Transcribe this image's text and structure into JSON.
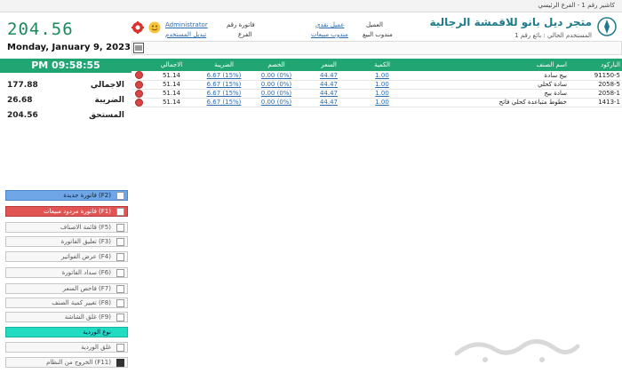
{
  "window": {
    "title": "كاشير رقم 1 - الفرع الرئيسي"
  },
  "totals": {
    "display_total": "204.56",
    "date": "Monday, January 9, 2023",
    "clock": "PM 09:58:55"
  },
  "summary": [
    {
      "label": "الاجمالي",
      "value": "177.88"
    },
    {
      "label": "الضريبة",
      "value": "26.68"
    },
    {
      "label": "المستحق",
      "value": "204.56"
    }
  ],
  "header": {
    "username_link": "Administrator",
    "change_user": "تبديل المستخدم",
    "invoice_label": "فاتورة رقم",
    "branch_label": "الفرع",
    "customer_link": "عميل نقدي",
    "rep_link": "مندوب مبيعات",
    "customer_label": "العميل",
    "rep_label": "مندوب البيع",
    "store_name": "متجر ديل بانو للاقمشة الرجالية",
    "current_user": "المستخدم الحالي : بائع رقم 1"
  },
  "table": {
    "columns": [
      "الباركود",
      "اسم الصنف",
      "الكمية",
      "السعر",
      "الخصم",
      "الضريبة",
      "الاجمالي"
    ],
    "rows": [
      {
        "barcode": "91150-5",
        "name": "بيج سادة",
        "qty": "1.00",
        "price": "44.47",
        "discount": "0.00 (0%)",
        "tax": "6.67 (15%)",
        "total": "51.14"
      },
      {
        "barcode": "2058-5",
        "name": "سادة كحلي",
        "qty": "1.00",
        "price": "44.47",
        "discount": "0.00 (0%)",
        "tax": "6.67 (15%)",
        "total": "51.14"
      },
      {
        "barcode": "2058-1",
        "name": "سادة بيج",
        "qty": "1.00",
        "price": "44.47",
        "discount": "0.00 (0%)",
        "tax": "6.67 (15%)",
        "total": "51.14"
      },
      {
        "barcode": "1413-1",
        "name": "خطوط متباعدة كحلي فاتح",
        "qty": "1.00",
        "price": "44.47",
        "discount": "0.00 (0%)",
        "tax": "6.67 (15%)",
        "total": "51.14"
      }
    ]
  },
  "sidebar": {
    "buttons": [
      {
        "label": "(F2) فاتورة جديدة",
        "style": "blue"
      },
      {
        "label": "(F1) فاتورة مردود مبيعات",
        "style": "red"
      },
      {
        "label": "(F5) قائمة الاصناف",
        "style": "plain"
      },
      {
        "label": "(F3) تعليق الفاتورة",
        "style": "plain"
      },
      {
        "label": "(F4) عرض الفواتير",
        "style": "plain"
      },
      {
        "label": "(F6) سداد الفاتورة",
        "style": "plain"
      },
      {
        "label": "(F7) فاحص السعر",
        "style": "plain"
      },
      {
        "label": "(F8) تغيير كمية الصنف",
        "style": "plain"
      },
      {
        "label": "(F9) غلق الشاشة",
        "style": "plain"
      },
      {
        "label": "نوع الوردية",
        "style": "teal"
      },
      {
        "label": "غلق الوردية",
        "style": "plain"
      },
      {
        "label": "(F11) الخروج من النظام",
        "style": "plain"
      }
    ]
  },
  "watermark": {
    "text": "حراج"
  },
  "colors": {
    "accent": "#21a573",
    "link": "#2b6cb0",
    "danger": "#d94545",
    "store": "#1d7c8c"
  }
}
